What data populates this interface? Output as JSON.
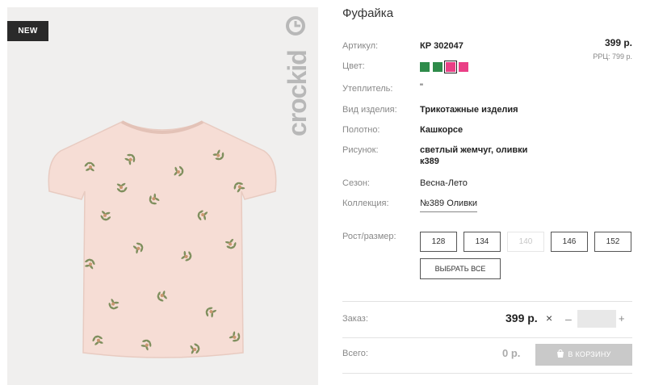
{
  "product": {
    "badge": "NEW",
    "brand": "crockid",
    "title": "Фуфайка",
    "price": "399 р.",
    "rrp": "РРЦ: 799 р.",
    "attributes": {
      "article_label": "Артикул:",
      "article_value": "КР 302047",
      "color_label": "Цвет:",
      "insulation_label": "Утеплитель:",
      "insulation_value": "\"",
      "type_label": "Вид изделия:",
      "type_value": "Трикотажные изделия",
      "fabric_label": "Полотно:",
      "fabric_value": "Кашкорсе",
      "pattern_label": "Рисунок:",
      "pattern_value_1": "светлый жемчуг, оливки",
      "pattern_value_2": "к389",
      "season_label": "Сезон:",
      "season_value": "Весна-Лето",
      "collection_label": "Коллекция:",
      "collection_value": "№389 Оливки"
    },
    "colors": [
      "#2e8b4a",
      "#2e8b4a",
      "#ea3f86",
      "#ea3f86"
    ],
    "selected_color_index": 2,
    "size_label": "Рост/размер:",
    "sizes": [
      {
        "label": "128",
        "available": true
      },
      {
        "label": "134",
        "available": true
      },
      {
        "label": "140",
        "available": false
      },
      {
        "label": "146",
        "available": true
      },
      {
        "label": "152",
        "available": true
      }
    ],
    "select_all": "ВЫБРАТЬ ВСЕ"
  },
  "order": {
    "label": "Заказ:",
    "price": "399 р.",
    "times": "×",
    "minus": "–",
    "plus": "+",
    "quantity": ""
  },
  "total": {
    "label": "Всего:",
    "value": "0 р.",
    "cart_button": "В КОРЗИНУ"
  },
  "icons": [
    "close-icon",
    "minus-icon",
    "plus-icon",
    "cart-icon",
    "brand-logo-icon"
  ]
}
